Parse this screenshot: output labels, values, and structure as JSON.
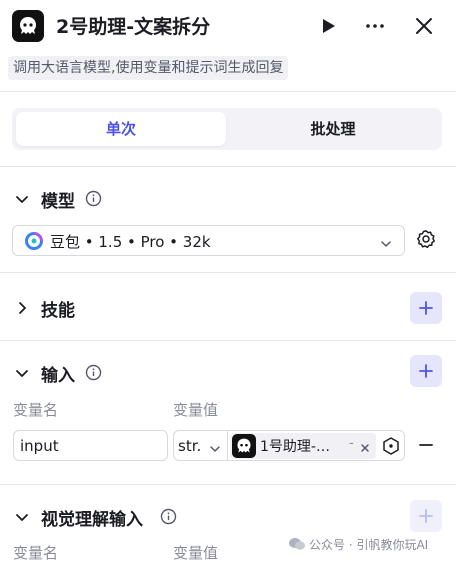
{
  "header": {
    "title": "2号助理-文案拆分",
    "description": "调用大语言模型,使用变量和提示词生成回复",
    "icons": [
      "assistant-icon",
      "play-icon",
      "more-icon",
      "close-icon"
    ]
  },
  "mode_tabs": [
    "单次",
    "批处理"
  ],
  "active_tab": "单次",
  "model_section": {
    "title": "模型",
    "selected": "豆包 • 1.5 • Pro • 32k"
  },
  "skills_section": {
    "title": "技能"
  },
  "inputs_section": {
    "title": "输入",
    "col_name": "变量名",
    "col_value": "变量值",
    "rows": [
      {
        "name": "input",
        "type": "str.",
        "value_tag": "1号助理-…",
        "value_suffix": "-"
      }
    ]
  },
  "visual_section": {
    "title": "视觉理解输入",
    "col_name": "变量名",
    "col_value": "变量值"
  },
  "watermark": "公众号 · 引帆教你玩AI",
  "colors": {
    "accent": "#4d53e8",
    "add_button_bg": "#e5e6fb",
    "divider": "#e6e6ee"
  }
}
